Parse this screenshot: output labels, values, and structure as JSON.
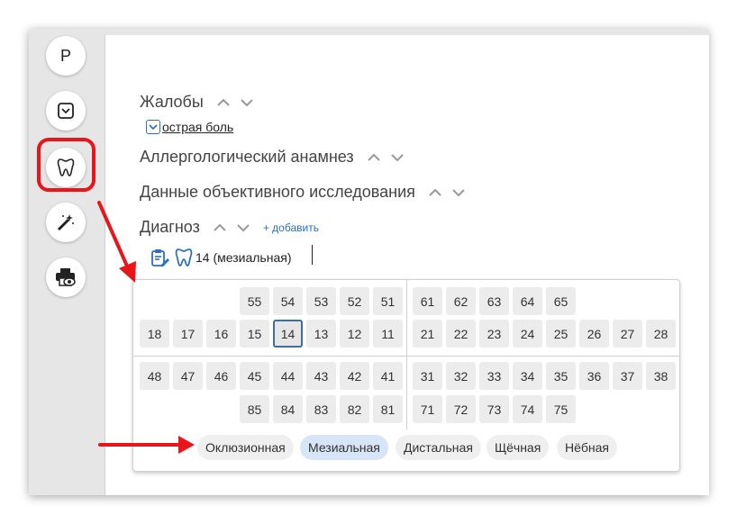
{
  "sidebar": {
    "profile_letter": "P",
    "icons": [
      "dropdown-box-icon",
      "tooth-icon",
      "magic-wand-icon",
      "print-preview-icon"
    ]
  },
  "sections": {
    "complaints": {
      "title": "Жалобы",
      "items": [
        "острая боль"
      ]
    },
    "allergy": {
      "title": "Аллергологический анамнез"
    },
    "objective": {
      "title": "Данные объективного исследования"
    },
    "diagnosis": {
      "title": "Диагноз",
      "add_label": "+ добавить",
      "entry": "14 (мезиальная)"
    }
  },
  "teeth": {
    "upper_right_primary": [
      "55",
      "54",
      "53",
      "52",
      "51"
    ],
    "upper_left_primary": [
      "61",
      "62",
      "63",
      "64",
      "65"
    ],
    "upper_right": [
      "18",
      "17",
      "16",
      "15",
      "14",
      "13",
      "12",
      "11"
    ],
    "upper_left": [
      "21",
      "22",
      "23",
      "24",
      "25",
      "26",
      "27",
      "28"
    ],
    "lower_right": [
      "48",
      "47",
      "46",
      "45",
      "44",
      "43",
      "42",
      "41"
    ],
    "lower_left": [
      "31",
      "32",
      "33",
      "34",
      "35",
      "36",
      "37",
      "38"
    ],
    "lower_right_primary": [
      "85",
      "84",
      "83",
      "82",
      "81"
    ],
    "lower_left_primary": [
      "71",
      "72",
      "73",
      "74",
      "75"
    ],
    "selected": "14"
  },
  "surfaces": [
    {
      "label": "Оклюзионная",
      "active": false
    },
    {
      "label": "Мезиальная",
      "active": true
    },
    {
      "label": "Дистальная",
      "active": false
    },
    {
      "label": "Щёчная",
      "active": false
    },
    {
      "label": "Нёбная",
      "active": false
    }
  ],
  "colors": {
    "accent": "#2a6fc0",
    "annotation_red": "#e8151a",
    "selected_border": "#3a6ea5",
    "active_surface": "#d6e5f7"
  }
}
